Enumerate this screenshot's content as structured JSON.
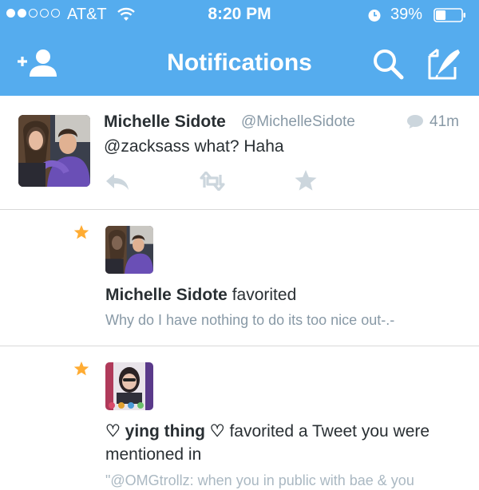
{
  "status_bar": {
    "carrier": "AT&T",
    "time": "8:20 PM",
    "battery": "39%",
    "battery_level": 0.39,
    "signal_bars_filled": 2,
    "signal_bars_total": 5
  },
  "nav": {
    "title": "Notifications",
    "left_icon": "add-user-icon",
    "right_icons": [
      "search-icon",
      "compose-icon"
    ]
  },
  "tweet": {
    "name": "Michelle Sidote",
    "handle": "@MichelleSidote",
    "time": "41m",
    "text": "@zacksass what? Haha"
  },
  "notifications": [
    {
      "actor": "Michelle Sidote",
      "action": " favorited",
      "snippet": "Why do I have nothing to do its too nice out-.-"
    },
    {
      "actor": "♡ ying thing ♡",
      "action": " favorited a Tweet you were mentioned in",
      "snippet": "\"@OMGtrollz: when you in public with bae & you"
    }
  ],
  "colors": {
    "brand": "#55acee",
    "star": "#ffac33",
    "muted": "#8899a6",
    "icon_gray": "#ccd6dd"
  }
}
